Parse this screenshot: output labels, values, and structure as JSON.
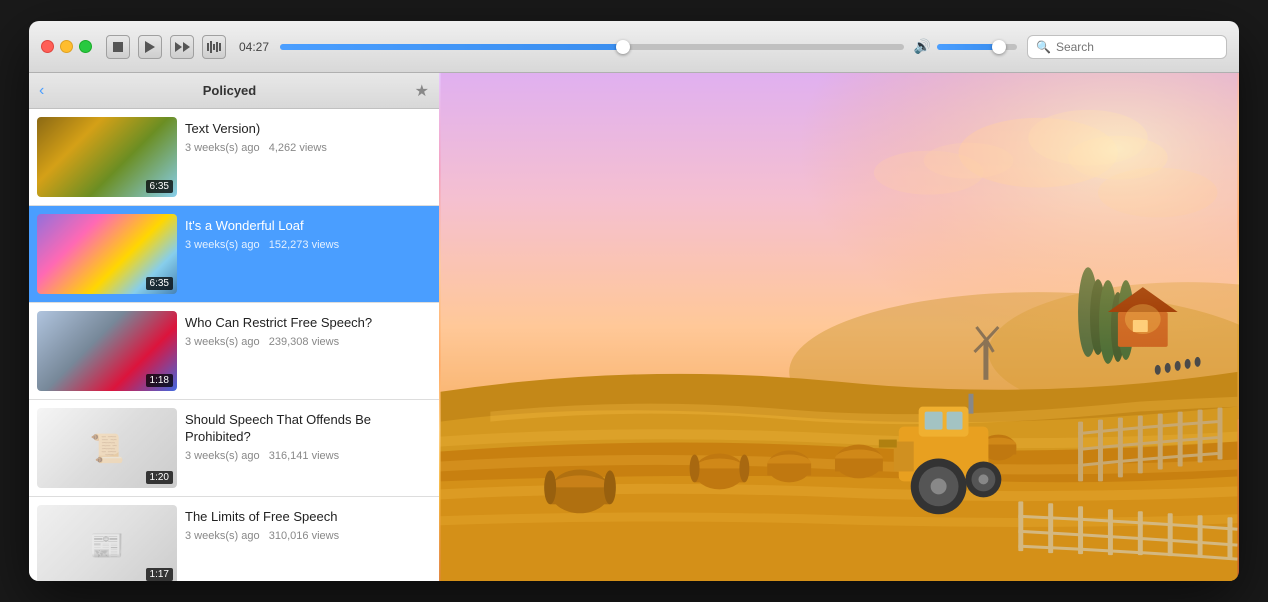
{
  "window": {
    "title": "Policyed"
  },
  "titlebar": {
    "time": "04:27",
    "progress_pct": 55,
    "volume_pct": 78,
    "search_placeholder": "Search",
    "stop_label": "stop",
    "play_label": "play",
    "ff_label": "fast-forward",
    "wave_label": "wave"
  },
  "sidebar": {
    "title": "Policyed",
    "back_label": "‹",
    "star_label": "★"
  },
  "videos": [
    {
      "id": 1,
      "title": "Text Version)",
      "age": "3 weeks(s) ago",
      "views": "4,262 views",
      "duration": "6:35",
      "active": false,
      "thumb_type": "1"
    },
    {
      "id": 2,
      "title": "It's a Wonderful Loaf",
      "age": "3 weeks(s) ago",
      "views": "152,273 views",
      "duration": "6:35",
      "active": true,
      "thumb_type": "2"
    },
    {
      "id": 3,
      "title": "Who Can Restrict Free Speech?",
      "age": "3 weeks(s) ago",
      "views": "239,308 views",
      "duration": "1:18",
      "active": false,
      "thumb_type": "3"
    },
    {
      "id": 4,
      "title": "Should Speech That Offends Be Prohibited?",
      "age": "3 weeks(s) ago",
      "views": "316,141 views",
      "duration": "1:20",
      "active": false,
      "thumb_type": "4"
    },
    {
      "id": 5,
      "title": "The Limits of Free Speech",
      "age": "3 weeks(s) ago",
      "views": "310,016 views",
      "duration": "1:17",
      "active": false,
      "thumb_type": "5"
    }
  ]
}
